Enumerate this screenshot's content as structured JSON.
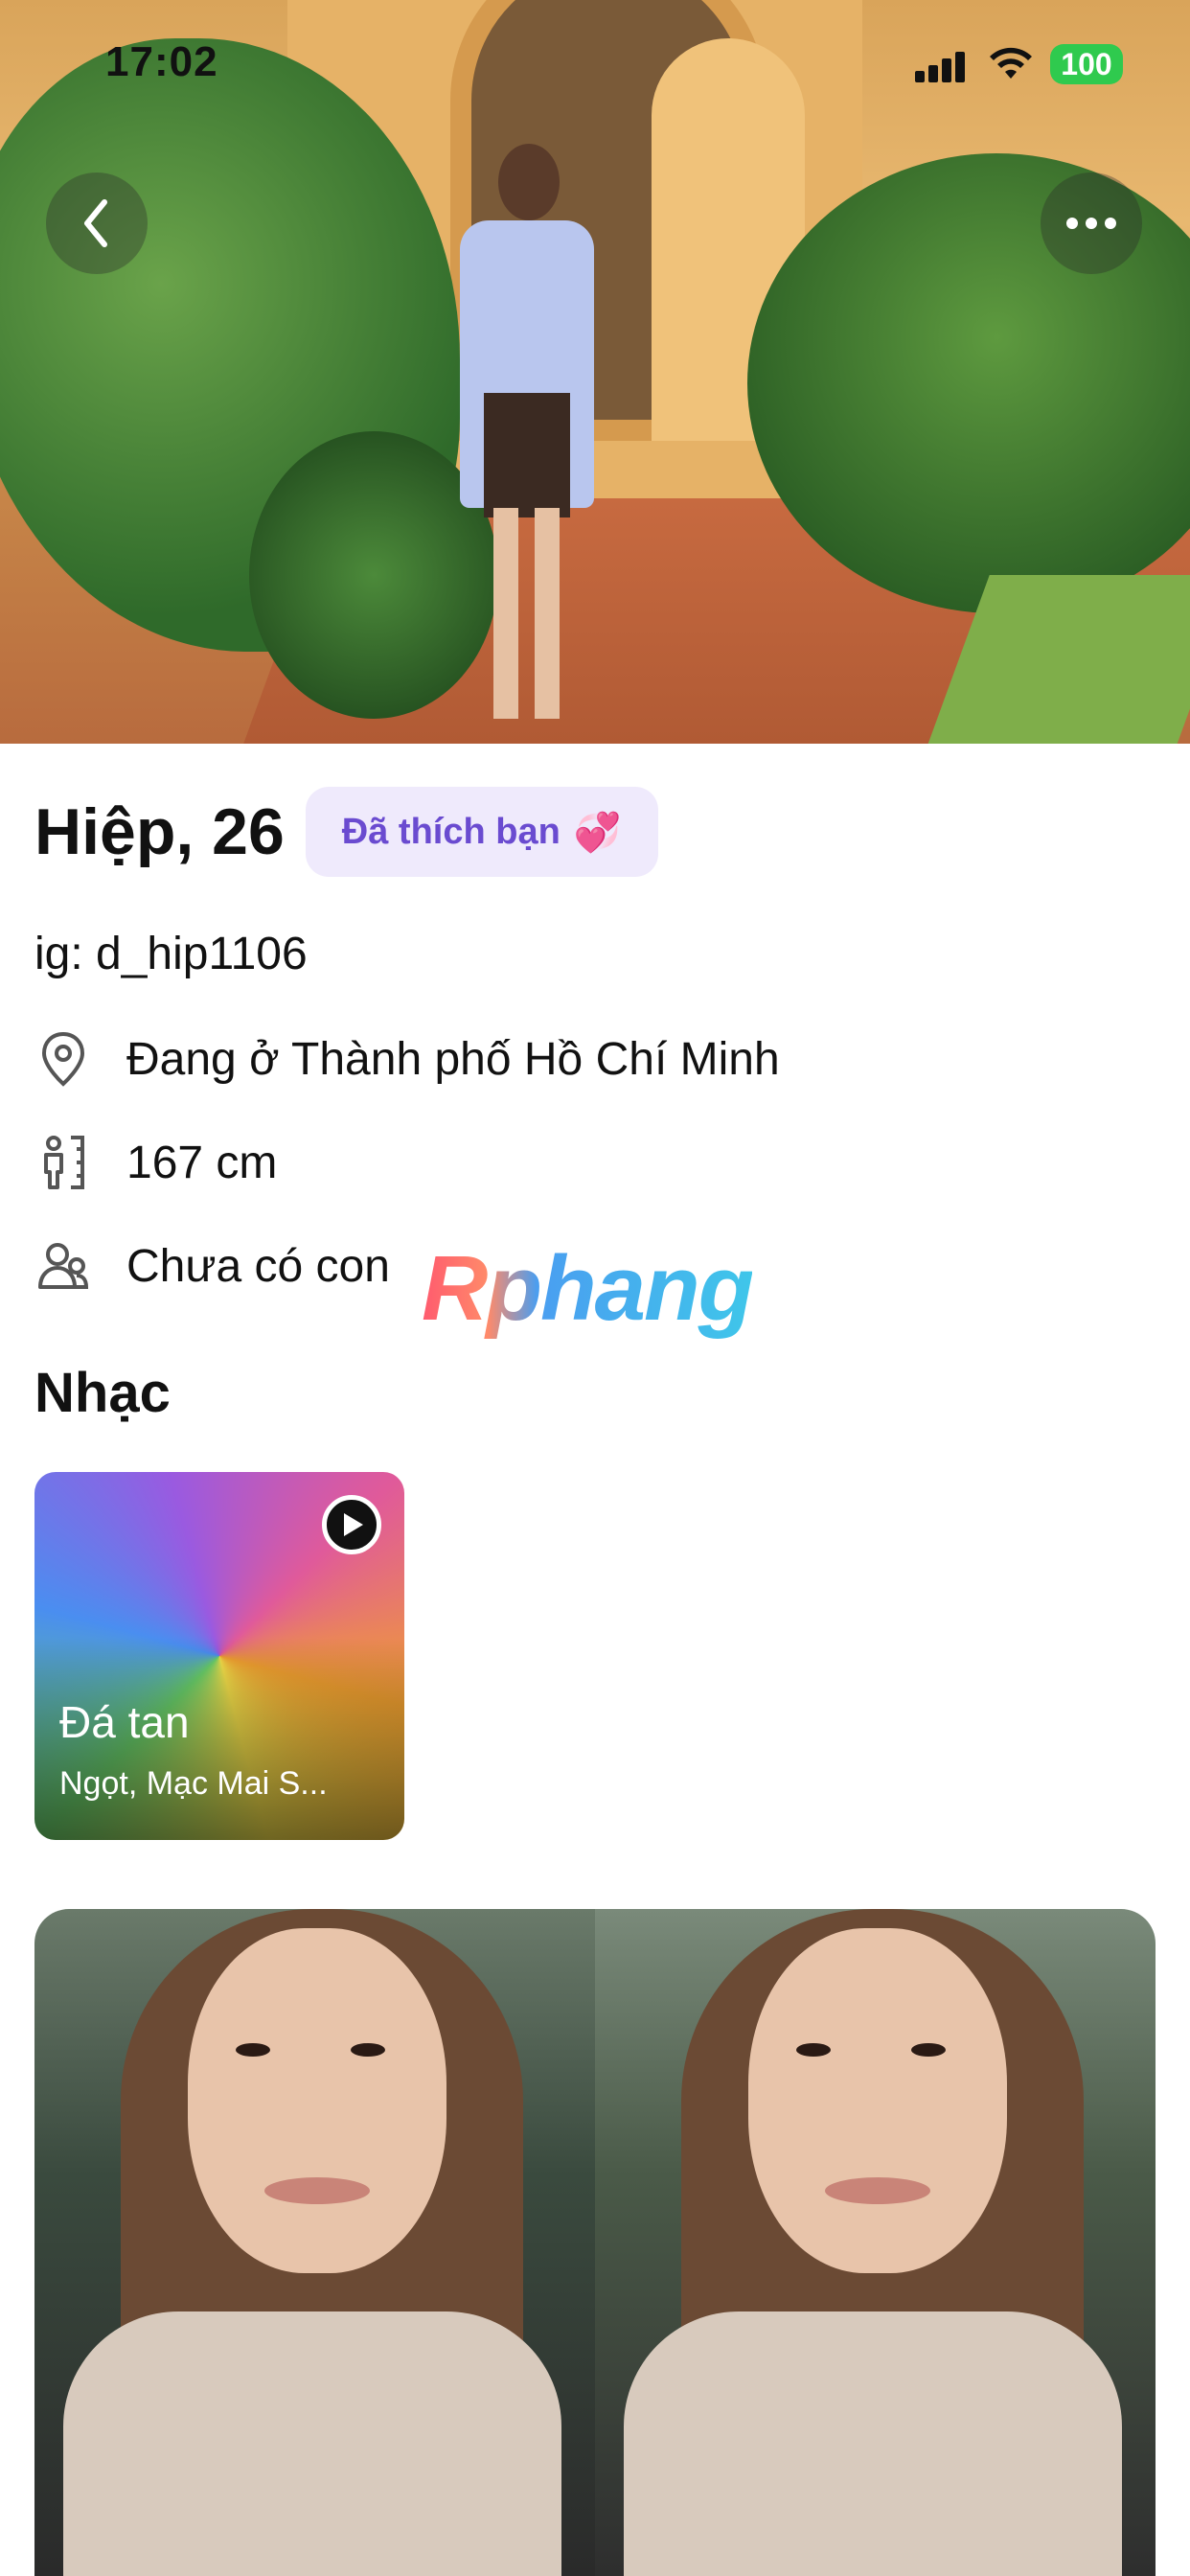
{
  "status_bar": {
    "time": "17:02",
    "battery": "100"
  },
  "profile": {
    "name_age": "Hiệp, 26",
    "liked_badge": "Đã thích bạn",
    "liked_emoji": "💞",
    "ig": "ig: d_hip1106",
    "location": "Đang ở Thành phố Hồ Chí Minh",
    "height": "167 cm",
    "children": "Chưa có con"
  },
  "watermark": "Rphang",
  "music": {
    "section_title": "Nhạc",
    "song_title": "Đá tan",
    "song_artist": "Ngọt, Mạc Mai S..."
  },
  "icons": {
    "back": "chevron-left-icon",
    "more": "ellipsis-icon",
    "location": "location-pin-icon",
    "height": "ruler-person-icon",
    "children": "users-icon",
    "play": "play-icon"
  },
  "colors": {
    "liked_bg": "#efeafc",
    "liked_text": "#6a4bd0",
    "battery": "#2fca4e"
  }
}
